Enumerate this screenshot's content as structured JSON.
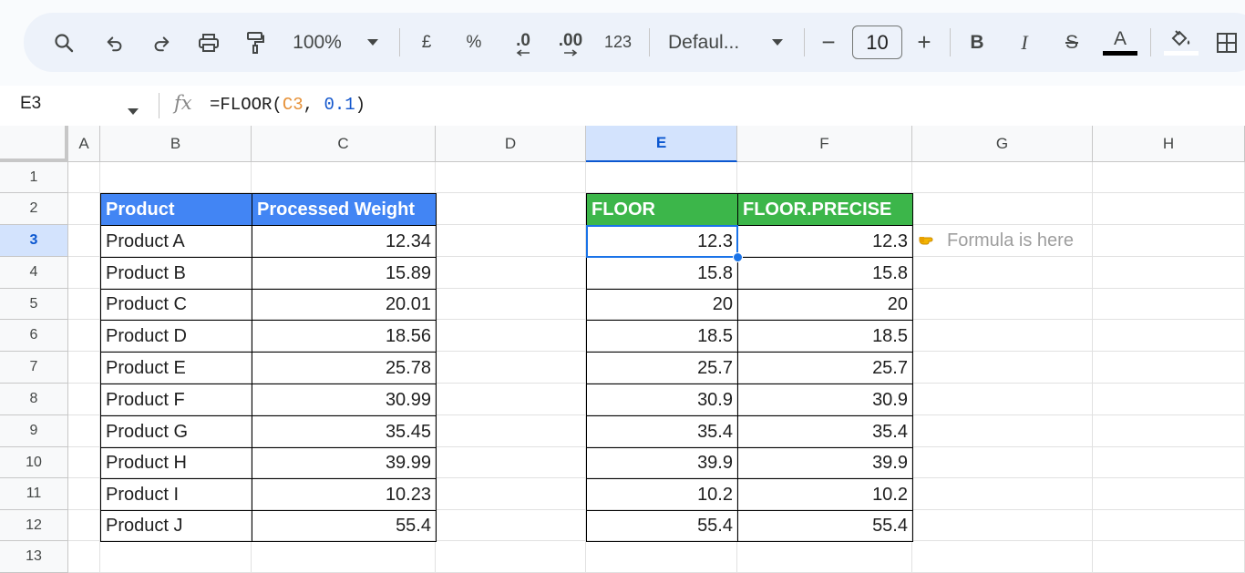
{
  "toolbar": {
    "zoom": "100%",
    "currency": "£",
    "percent": "%",
    "dec_decrease": ".0",
    "dec_increase": ".00",
    "number_format": "123",
    "font_name": "Defaul...",
    "font_size_minus": "−",
    "font_size": "10",
    "font_size_plus": "+",
    "bold": "B",
    "italic": "I",
    "strike": "S",
    "text_color_letter": "A",
    "accent_colors": {
      "text_color_bar": "#000000",
      "selection": "#1a73e8"
    }
  },
  "formula_bar": {
    "name_box": "E3",
    "fx": "fx",
    "formula_prefix": "=FLOOR(",
    "formula_ref": "C3",
    "formula_sep": ", ",
    "formula_num": "0.1",
    "formula_suffix": ")"
  },
  "columns": [
    "A",
    "B",
    "C",
    "D",
    "E",
    "F",
    "G",
    "H"
  ],
  "rows": [
    "1",
    "2",
    "3",
    "4",
    "5",
    "6",
    "7",
    "8",
    "9",
    "10",
    "11",
    "12",
    "13"
  ],
  "selected_cell": "E3",
  "table1": {
    "headers": [
      "Product",
      "Processed Weight"
    ],
    "header_color": "#4285f4",
    "rows": [
      [
        "Product A",
        "12.34"
      ],
      [
        "Product B",
        "15.89"
      ],
      [
        "Product C",
        "20.01"
      ],
      [
        "Product D",
        "18.56"
      ],
      [
        "Product E",
        "25.78"
      ],
      [
        "Product F",
        "30.99"
      ],
      [
        "Product G",
        "35.45"
      ],
      [
        "Product H",
        "39.99"
      ],
      [
        "Product I",
        "10.23"
      ],
      [
        "Product J",
        "55.4"
      ]
    ]
  },
  "table2": {
    "headers": [
      "FLOOR",
      "FLOOR.PRECISE"
    ],
    "header_color": "#3cb64a",
    "rows": [
      [
        "12.3",
        "12.3"
      ],
      [
        "15.8",
        "15.8"
      ],
      [
        "20",
        "20"
      ],
      [
        "18.5",
        "18.5"
      ],
      [
        "25.7",
        "25.7"
      ],
      [
        "30.9",
        "30.9"
      ],
      [
        "35.4",
        "35.4"
      ],
      [
        "39.9",
        "39.9"
      ],
      [
        "10.2",
        "10.2"
      ],
      [
        "55.4",
        "55.4"
      ]
    ]
  },
  "note": {
    "icon": "pointing-hand-icon",
    "text": "Formula is here"
  }
}
